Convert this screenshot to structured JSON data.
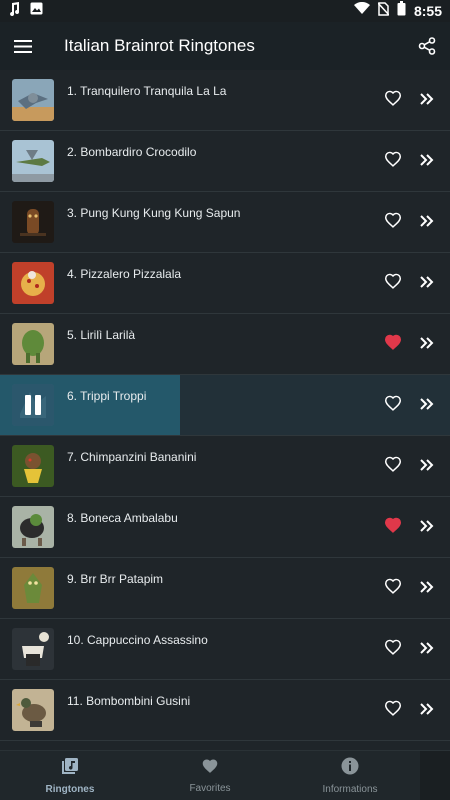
{
  "status_bar": {
    "time": "8:55",
    "icons": [
      "music-note-icon",
      "image-icon",
      "wifi-icon",
      "no-sim-icon",
      "battery-icon"
    ]
  },
  "app_bar": {
    "title": "Italian Brainrot Ringtones",
    "menu_icon": "hamburger-menu-icon",
    "share_icon": "share-icon"
  },
  "colors": {
    "favorite_active": "#e0384a",
    "favorite_inactive": "#ffffff",
    "playing_progress": "#24586a",
    "background": "#1f2529"
  },
  "ringtones": [
    {
      "title": "1. Tranquilero Tranquila La La",
      "favorite": false,
      "playing": false
    },
    {
      "title": "2. Bombardiro Crocodilo",
      "favorite": false,
      "playing": false
    },
    {
      "title": "3. Pung Kung Kung Kung Sapun",
      "favorite": false,
      "playing": false
    },
    {
      "title": "4. Pizzalero Pizzalala",
      "favorite": false,
      "playing": false
    },
    {
      "title": "5. Lirilì Larilà",
      "favorite": true,
      "playing": false
    },
    {
      "title": "6. Trippi Troppi",
      "favorite": false,
      "playing": true,
      "progress": 0.4
    },
    {
      "title": "7. Chimpanzini Bananini",
      "favorite": false,
      "playing": false
    },
    {
      "title": "8. Boneca Ambalabu",
      "favorite": true,
      "playing": false
    },
    {
      "title": "9. Brr Brr Patapim",
      "favorite": false,
      "playing": false
    },
    {
      "title": "10. Cappuccino Assassino",
      "favorite": false,
      "playing": false
    },
    {
      "title": "11. Bombombini Gusini",
      "favorite": false,
      "playing": false
    }
  ],
  "bottom_nav": {
    "items": [
      {
        "label": "Ringtones",
        "icon": "music-library-icon",
        "active": true
      },
      {
        "label": "Favorites",
        "icon": "heart-icon",
        "active": false
      },
      {
        "label": "Informations",
        "icon": "info-icon",
        "active": false
      }
    ]
  }
}
